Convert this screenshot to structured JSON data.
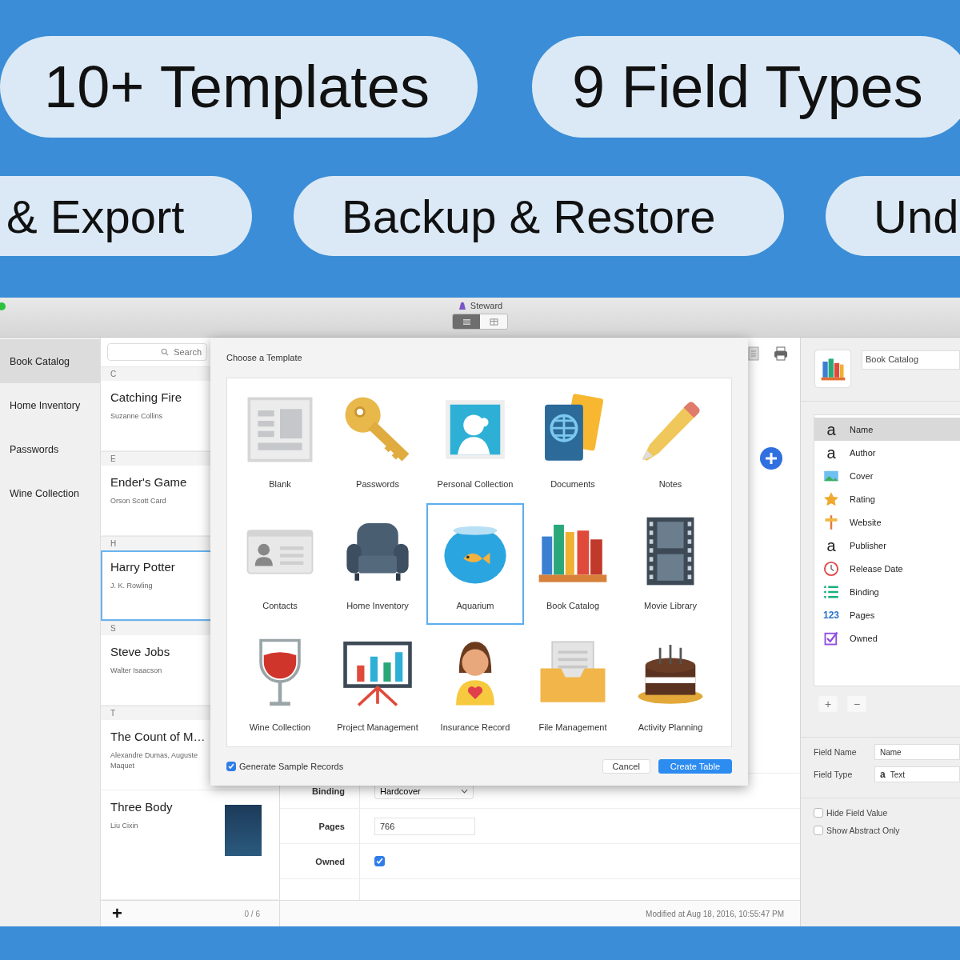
{
  "banner": {
    "rows": [
      [
        {
          "text": "10+ Templates"
        },
        {
          "text": "9 Field Types"
        }
      ],
      [
        {
          "text": "& Export"
        },
        {
          "text": "Backup & Restore"
        },
        {
          "text": "Und"
        }
      ]
    ]
  },
  "window": {
    "title": "Steward",
    "view_modes": [
      {
        "selected": true
      },
      {
        "selected": false
      }
    ]
  },
  "sidebar": {
    "items": [
      {
        "label": "Book Catalog",
        "selected": true
      },
      {
        "label": "Home Inventory",
        "selected": false
      },
      {
        "label": "Passwords",
        "selected": false
      },
      {
        "label": "Wine Collection",
        "selected": false
      }
    ]
  },
  "records": {
    "search": {
      "placeholder": "Search"
    },
    "sections": [
      {
        "letter": "C",
        "items": [
          {
            "title": "Catching Fire",
            "subtitle": "Suzanne Collins",
            "selected": false,
            "cover": false
          }
        ]
      },
      {
        "letter": "E",
        "items": [
          {
            "title": "Ender's Game",
            "subtitle": "Orson Scott Card",
            "selected": false,
            "cover": false
          }
        ]
      },
      {
        "letter": "H",
        "items": [
          {
            "title": "Harry Potter",
            "subtitle": "J. K. Rowling",
            "selected": true,
            "cover": false
          }
        ]
      },
      {
        "letter": "S",
        "items": [
          {
            "title": "Steve Jobs",
            "subtitle": "Walter Isaacson",
            "selected": false,
            "cover": false
          }
        ]
      },
      {
        "letter": "T",
        "items": [
          {
            "title": "The Count of M…",
            "subtitle": "Alexandre Dumas, Auguste Maquet",
            "selected": false,
            "cover": false
          },
          {
            "title": "Three Body",
            "subtitle": "Liu Cixin",
            "selected": false,
            "cover": true
          }
        ]
      }
    ],
    "add": "+",
    "count": "0 / 6"
  },
  "detail": {
    "fields": [
      {
        "label": "Binding",
        "kind": "select",
        "value": "Hardcover"
      },
      {
        "label": "Pages",
        "kind": "text",
        "value": "766"
      },
      {
        "label": "Owned",
        "kind": "checkbox",
        "checked": true
      }
    ],
    "status": "Modified at Aug 18, 2016, 10:55:47 PM"
  },
  "dialog": {
    "title": "Choose a Template",
    "templates": [
      {
        "label": "Blank",
        "selected": false
      },
      {
        "label": "Passwords",
        "selected": false
      },
      {
        "label": "Personal Collection",
        "selected": false
      },
      {
        "label": "Documents",
        "selected": false
      },
      {
        "label": "Notes",
        "selected": false
      },
      {
        "label": "Contacts",
        "selected": false
      },
      {
        "label": "Home Inventory",
        "selected": false
      },
      {
        "label": "Aquarium",
        "selected": true
      },
      {
        "label": "Book Catalog",
        "selected": false
      },
      {
        "label": "Movie Library",
        "selected": false
      },
      {
        "label": "Wine Collection",
        "selected": false
      },
      {
        "label": "Project Management",
        "selected": false
      },
      {
        "label": "Insurance Record",
        "selected": false
      },
      {
        "label": "File Management",
        "selected": false
      },
      {
        "label": "Activity Planning",
        "selected": false
      }
    ],
    "sample_records": {
      "label": "Generate Sample Records",
      "checked": true
    },
    "buttons": [
      {
        "label": "Cancel",
        "kind": "default"
      },
      {
        "label": "Create Table",
        "kind": "primary"
      }
    ]
  },
  "inspector": {
    "table_name": "Book Catalog",
    "fields": [
      {
        "name": "Name",
        "kind": "text",
        "glyph": "a",
        "selected": true
      },
      {
        "name": "Author",
        "kind": "text",
        "glyph": "a",
        "selected": false
      },
      {
        "name": "Cover",
        "kind": "image",
        "selected": false
      },
      {
        "name": "Rating",
        "kind": "rating",
        "selected": false
      },
      {
        "name": "Website",
        "kind": "link",
        "selected": false
      },
      {
        "name": "Publisher",
        "kind": "text",
        "glyph": "a",
        "selected": false
      },
      {
        "name": "Release Date",
        "kind": "date",
        "selected": false
      },
      {
        "name": "Binding",
        "kind": "list",
        "selected": false
      },
      {
        "name": "Pages",
        "kind": "number",
        "glyph": "123",
        "selected": false
      },
      {
        "name": "Owned",
        "kind": "checkbox",
        "selected": false
      }
    ],
    "add": "+",
    "remove": "−",
    "field_name": {
      "label": "Field Name",
      "value": "Name"
    },
    "field_type": {
      "label": "Field Type",
      "glyph": "a",
      "value": "Text"
    },
    "options": [
      {
        "label": "Hide Field Value",
        "checked": false
      },
      {
        "label": "Show Abstract Only",
        "checked": false
      }
    ]
  }
}
